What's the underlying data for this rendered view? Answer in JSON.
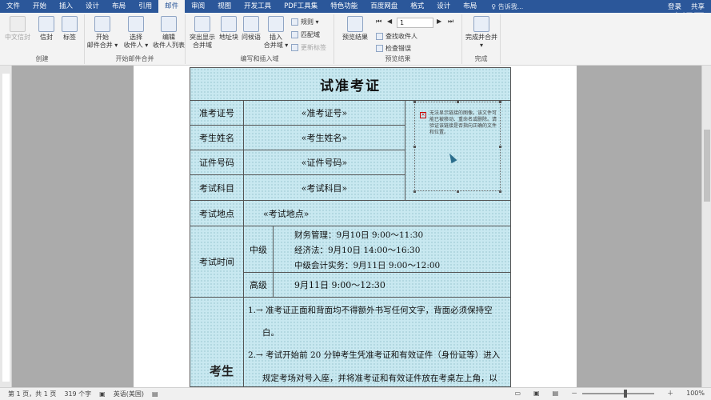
{
  "tabs": [
    "文件",
    "开始",
    "插入",
    "设计",
    "布局",
    "引用",
    "邮件",
    "审阅",
    "视图",
    "开发工具",
    "PDF工具集",
    "特色功能",
    "百度网盘",
    "格式",
    "设计",
    "布局"
  ],
  "active_tab": "邮件",
  "tell_me": "♀ 告诉我...",
  "login": "登录",
  "share": "共享",
  "watermark": "◎虎课网",
  "ribbon": {
    "groups": {
      "create": "创建",
      "start_merge": "开始邮件合并",
      "write_insert": "编写和插入域",
      "preview": "预览结果",
      "finish": "完成"
    },
    "buttons": {
      "cn_envelope": "中文信封",
      "envelope": "信封",
      "labels": "标签",
      "start_merge": "开始\n邮件合并 ▾",
      "select_recipients": "选择\n收件人 ▾",
      "edit_list": "编辑\n收件人列表",
      "highlight": "突出显示\n合并域",
      "address_block": "地址块",
      "greeting": "问候语",
      "insert_field": "插入\n合并域 ▾",
      "rules": "规则 ▾",
      "match": "匹配域",
      "update_labels": "更新标签",
      "preview_results": "预览结果",
      "record": "1",
      "find_recipient": "查找收件人",
      "check_errors": "检查错误",
      "finish_merge": "完成并合并\n▾"
    }
  },
  "doc": {
    "title": "试准考证",
    "rows": {
      "exam_no_label": "准考证号",
      "exam_no_field": "«准考证号»",
      "name_label": "考生姓名",
      "name_field": "«考生姓名»",
      "id_label": "证件号码",
      "id_field": "«证件号码»",
      "subject_label": "考试科目",
      "subject_field": "«考试科目»",
      "place_label": "考试地点",
      "place_field": "«考试地点»",
      "time_label": "考试时间",
      "mid_label": "中级",
      "mid_lines": [
        "财务管理：9月10日 9:00～11:30",
        "经济法：9月10日 14:00～16:30",
        "中级会计实务：9月11日 9:00～12:00"
      ],
      "high_label": "高级",
      "high_line": "9月11日 9:00～12:30"
    },
    "photo_msg": "无法显示链接的图像。该文件可能已被移动、重命名或删除。请验证该链接是否指向正确的文件和位置。",
    "notes": [
      "1.→ 准考证正面和背面均不得额外书写任何文字，背面必须保持空",
      "白。",
      "2.→ 考试开始前 20 分钟考生凭准考证和有效证件（身份证等）进入",
      "规定考场对号入座，并将准考证和有效证件放在考桌左上角，以"
    ],
    "side_label": "考生"
  },
  "status": {
    "pages": "第 1 页，共 1 页",
    "words": "319 个字",
    "lang": "英语(美国)",
    "zoom": "100%"
  }
}
